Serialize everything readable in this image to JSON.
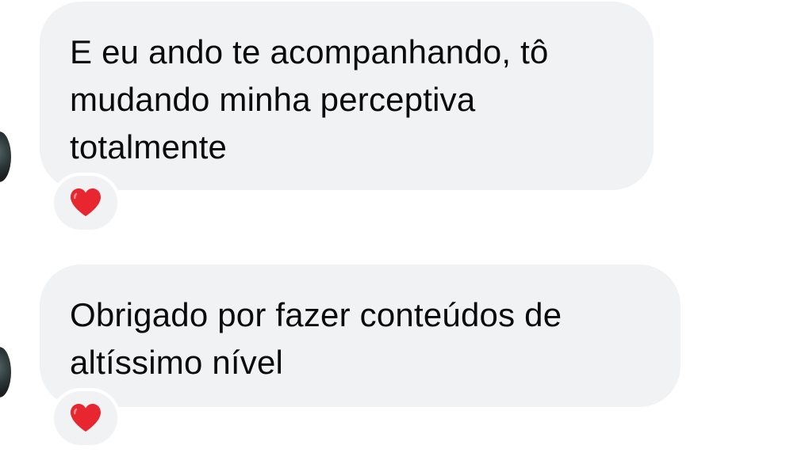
{
  "messages": [
    {
      "text": "E eu ando te acompanhando, tô mudando minha perceptiva totalmente",
      "reaction": "heart-icon"
    },
    {
      "text": "Obrigado por fazer conteúdos de altíssimo nível",
      "reaction": "heart-icon"
    }
  ],
  "colors": {
    "bubble_background": "#f1f2f4",
    "text": "#0b0b0c",
    "heart": "#e8262f"
  }
}
